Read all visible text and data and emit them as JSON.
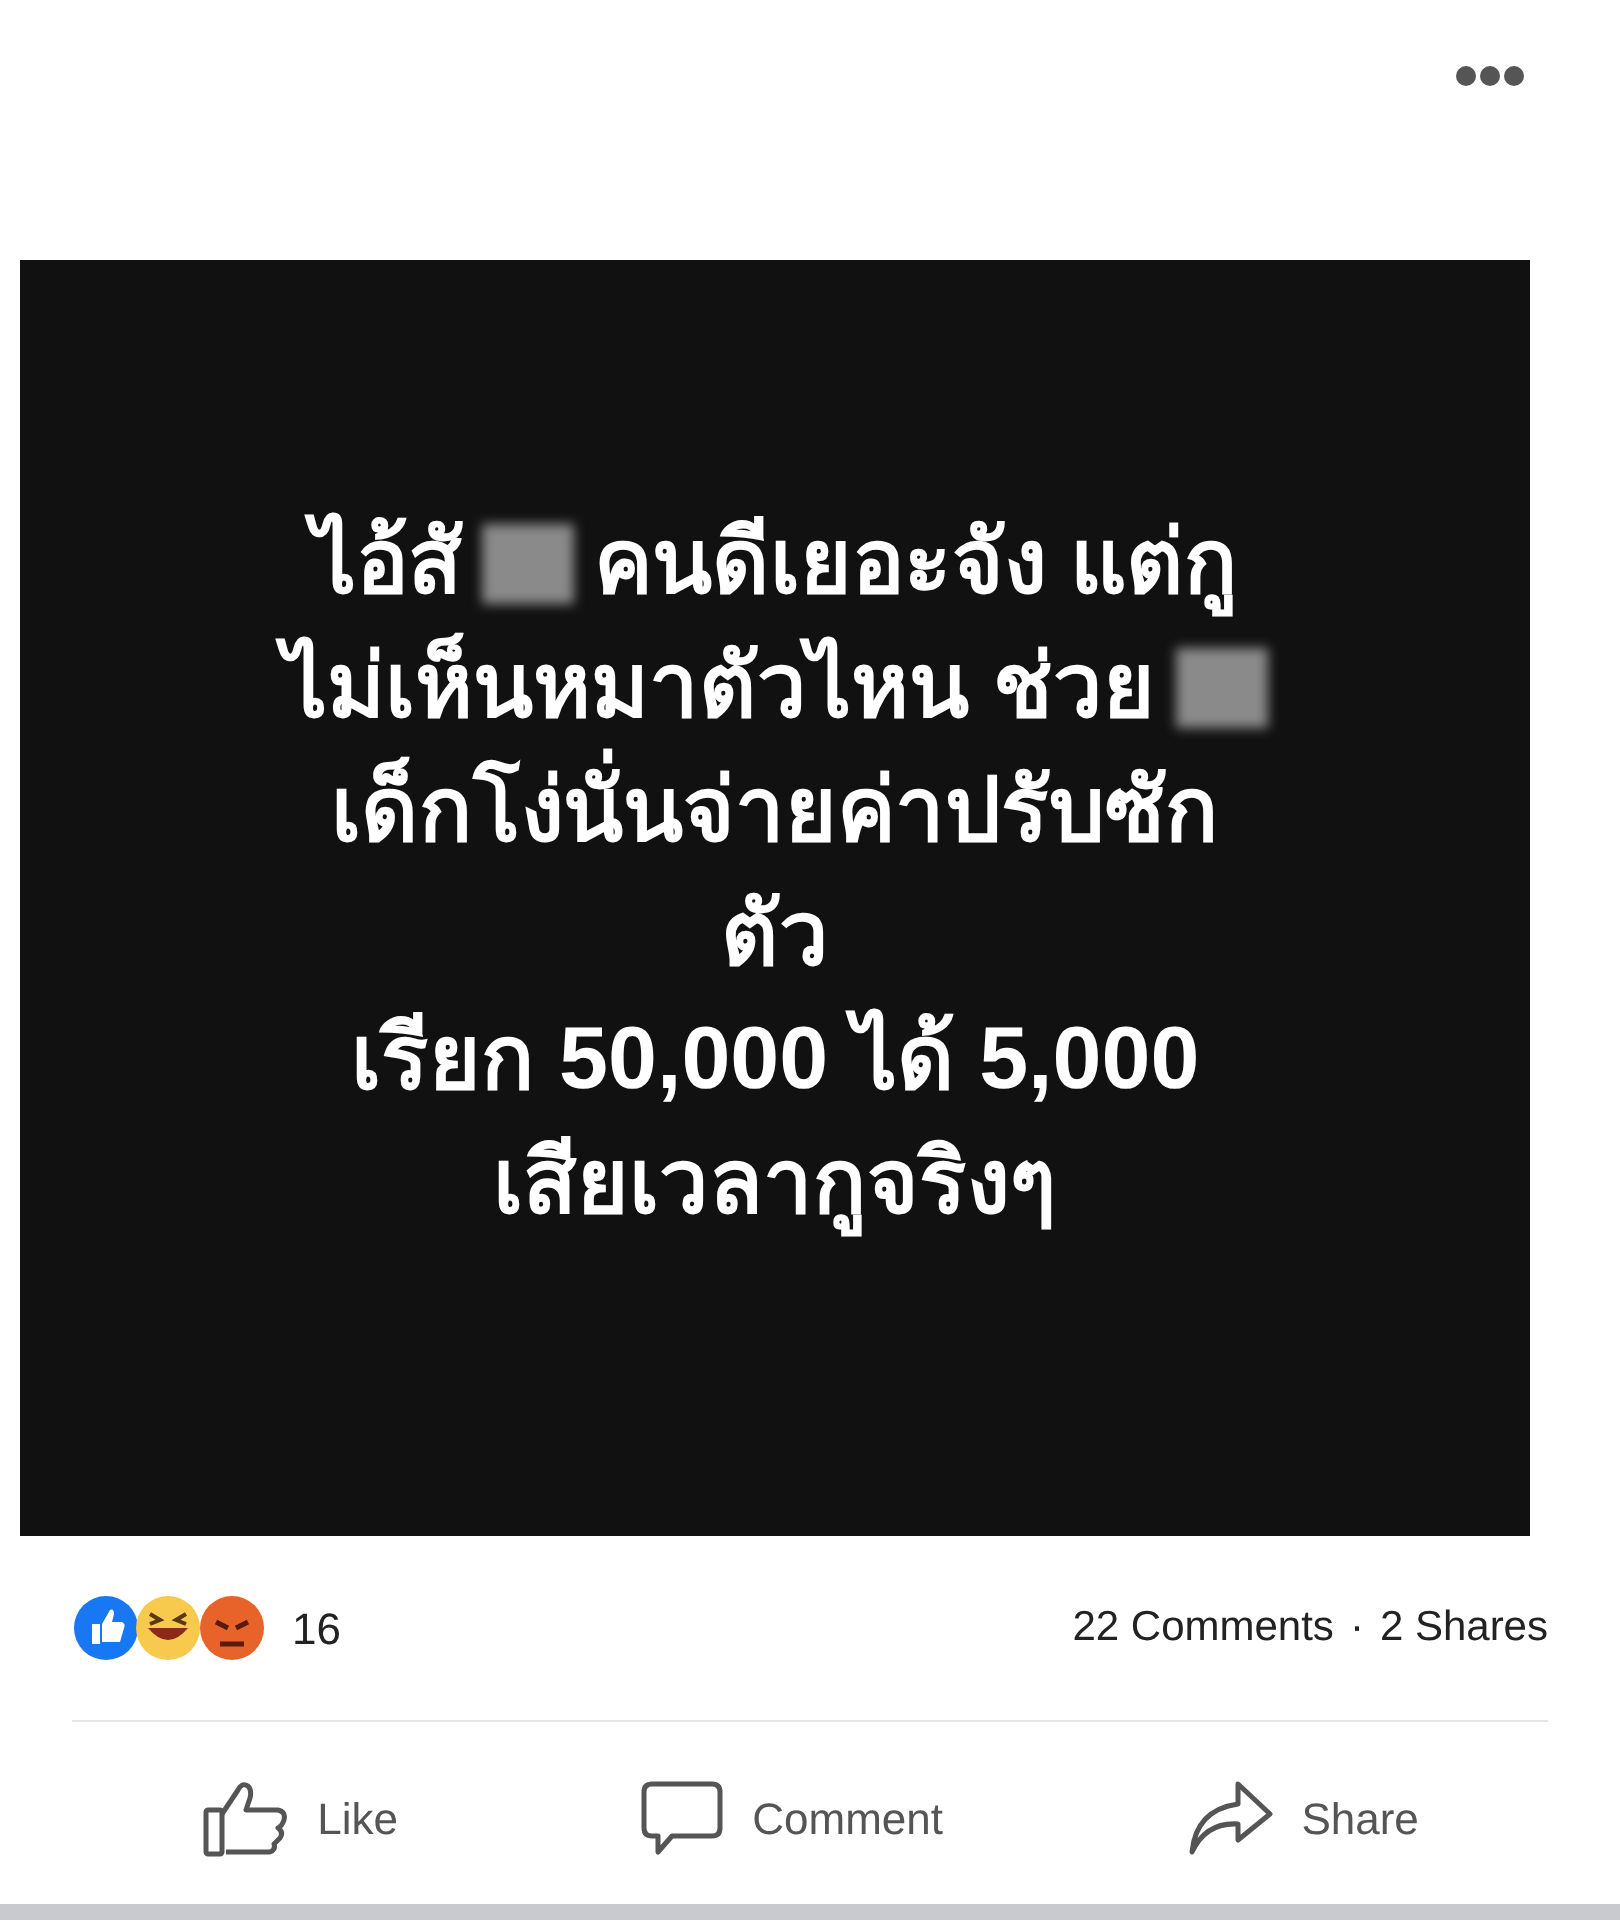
{
  "post": {
    "lines": [
      [
        {
          "kind": "text",
          "text": "ไอ้สั"
        },
        {
          "kind": "censored"
        },
        {
          "kind": "text",
          "text": "คนดีเยอะจัง แต่กู"
        }
      ],
      [
        {
          "kind": "text",
          "text": "ไม่เห็นหมาตัวไหน ช่วย"
        },
        {
          "kind": "censored"
        }
      ],
      [
        {
          "kind": "text",
          "text": "เด็กโง่นั่นจ่ายค่าปรับซัก"
        }
      ],
      [
        {
          "kind": "text",
          "text": "ตัว"
        }
      ],
      [
        {
          "kind": "text",
          "text": "เรียก 50,000 ได้ 5,000"
        }
      ],
      [
        {
          "kind": "text",
          "text": "เสียเวลากูจริงๆ"
        }
      ]
    ]
  },
  "reactions": {
    "count": "16",
    "comments": "22 Comments",
    "separator": "·",
    "shares": "2 Shares"
  },
  "actions": [
    {
      "kind": "like",
      "label": "Like"
    },
    {
      "kind": "comment",
      "label": "Comment"
    },
    {
      "kind": "share",
      "label": "Share"
    }
  ]
}
